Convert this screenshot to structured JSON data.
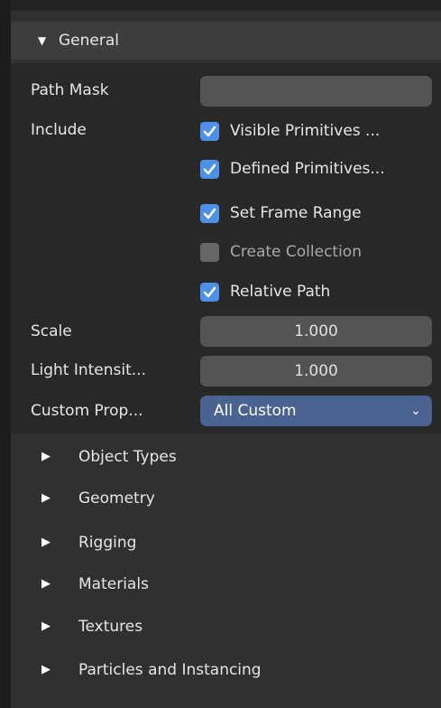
{
  "general": {
    "title": "General",
    "expanded_icon": "triangle-down",
    "path_mask": {
      "label": "Path Mask",
      "value": ""
    },
    "include": {
      "label": "Include",
      "options": [
        {
          "label": "Visible Primitives ...",
          "checked": true
        },
        {
          "label": "Defined Primitives...",
          "checked": true
        },
        {
          "label": "Set Frame Range",
          "checked": true
        },
        {
          "label": "Create Collection",
          "checked": false
        },
        {
          "label": "Relative Path",
          "checked": true
        }
      ]
    },
    "scale": {
      "label": "Scale",
      "value": "1.000"
    },
    "light_intensity": {
      "label": "Light Intensit...",
      "value": "1.000"
    },
    "custom_props": {
      "label": "Custom Prop...",
      "value": "All Custom"
    }
  },
  "sections": [
    {
      "title": "Object Types"
    },
    {
      "title": "Geometry"
    },
    {
      "title": "Rigging"
    },
    {
      "title": "Materials"
    },
    {
      "title": "Textures"
    },
    {
      "title": "Particles and Instancing"
    }
  ],
  "colors": {
    "background": "#1d1d1d",
    "panel": "#303030",
    "header": "#3d3d3d",
    "field": "#545454",
    "dropdown": "#4a6391",
    "checkbox_on": "#4c90e8",
    "checkbox_off": "#666666"
  }
}
